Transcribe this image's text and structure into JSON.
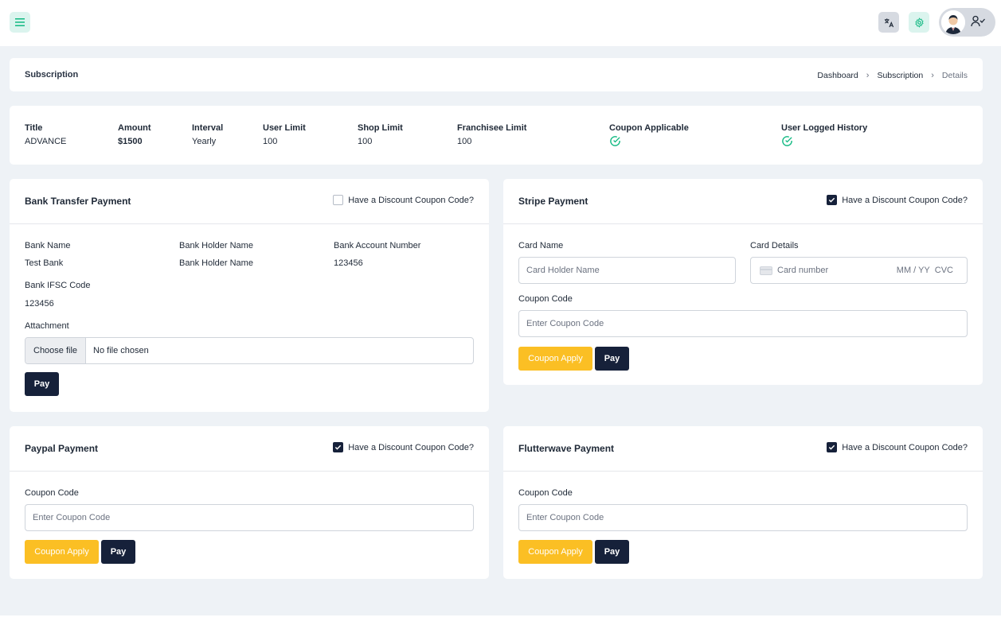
{
  "icons": {
    "menu": "menu-icon",
    "translate": "translate-icon",
    "settings": "gear-icon",
    "profile": "user-check-icon",
    "check": "check-circle-icon",
    "card": "credit-card-icon"
  },
  "colors": {
    "accent_green": "#10b981",
    "dark_button": "#16213a",
    "yellow_button": "#fbbf24"
  },
  "header": {
    "title": "Subscription",
    "breadcrumb": [
      "Dashboard",
      "Subscription",
      "Details"
    ]
  },
  "summary": {
    "title_label": "Title",
    "title_value": "ADVANCE",
    "amount_label": "Amount",
    "amount_value": "$1500",
    "interval_label": "Interval",
    "interval_value": "Yearly",
    "user_limit_label": "User Limit",
    "user_limit_value": "100",
    "shop_limit_label": "Shop Limit",
    "shop_limit_value": "100",
    "franchisee_limit_label": "Franchisee Limit",
    "franchisee_limit_value": "100",
    "coupon_applicable_label": "Coupon Applicable",
    "user_logged_history_label": "User Logged History"
  },
  "bank": {
    "title": "Bank Transfer Payment",
    "coupon_toggle": "Have a Discount Coupon Code?",
    "bank_name_label": "Bank Name",
    "bank_name_value": "Test Bank",
    "holder_label": "Bank Holder Name",
    "holder_value": "Bank Holder Name",
    "account_label": "Bank Account Number",
    "account_value": "123456",
    "ifsc_label": "Bank IFSC Code",
    "ifsc_value": "123456",
    "attachment_label": "Attachment",
    "choose_file": "Choose file",
    "no_file": "No file chosen",
    "pay": "Pay"
  },
  "stripe": {
    "title": "Stripe Payment",
    "coupon_toggle": "Have a Discount Coupon Code?",
    "card_name_label": "Card Name",
    "card_name_placeholder": "Card Holder Name",
    "card_details_label": "Card Details",
    "card_number_placeholder": "Card number",
    "card_expiry_placeholder": "MM / YY",
    "card_cvc_placeholder": "CVC",
    "coupon_label": "Coupon Code",
    "coupon_placeholder": "Enter Coupon Code",
    "coupon_apply": "Coupon Apply",
    "pay": "Pay"
  },
  "paypal": {
    "title": "Paypal Payment",
    "coupon_toggle": "Have a Discount Coupon Code?",
    "coupon_label": "Coupon Code",
    "coupon_placeholder": "Enter Coupon Code",
    "coupon_apply": "Coupon Apply",
    "pay": "Pay"
  },
  "flutterwave": {
    "title": "Flutterwave Payment",
    "coupon_toggle": "Have a Discount Coupon Code?",
    "coupon_label": "Coupon Code",
    "coupon_placeholder": "Enter Coupon Code",
    "coupon_apply": "Coupon Apply",
    "pay": "Pay"
  }
}
